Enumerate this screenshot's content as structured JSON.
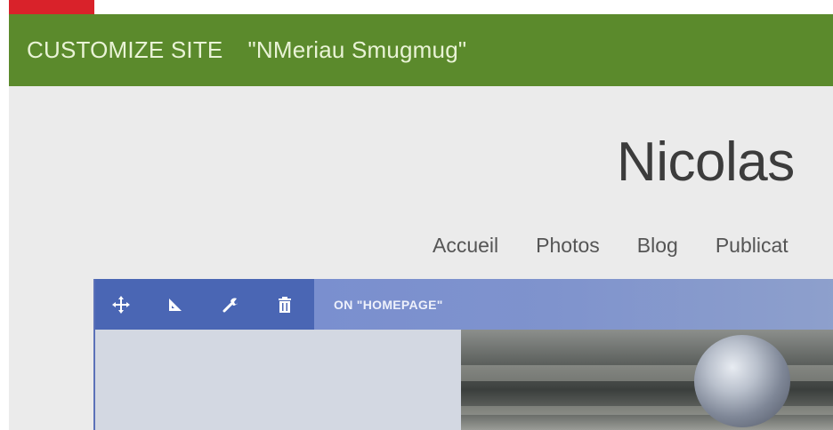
{
  "customize_bar": {
    "label": "CUSTOMIZE SITE",
    "site_name": "\"NMeriau Smugmug\""
  },
  "site": {
    "title": "Nicolas",
    "nav": [
      "Accueil",
      "Photos",
      "Blog",
      "Publicat"
    ]
  },
  "block": {
    "tools": [
      "move-icon",
      "resize-icon",
      "wrench-icon",
      "trash-icon"
    ],
    "label": "ON \"HOMEPAGE\""
  },
  "colors": {
    "customize_bar": "#5b8a2c",
    "toolbar": "#4a66b4",
    "logo": "#d9222a"
  }
}
